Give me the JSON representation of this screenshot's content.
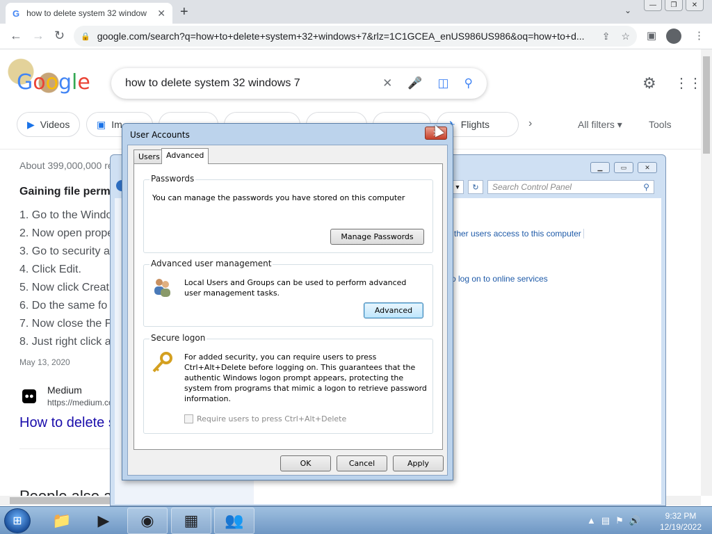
{
  "browser": {
    "tab_title": "how to delete system 32 window",
    "favicon": "G",
    "url": "google.com/search?q=how+to+delete+system+32+windows+7&rlz=1C1GCEA_enUS986US986&oq=how+to+d..."
  },
  "google": {
    "logo": "Google",
    "query": "how to delete system 32 windows 7",
    "chips": [
      "Videos",
      "Im",
      "",
      "",
      "",
      "",
      "Flights"
    ],
    "all_filters": "All filters",
    "tools": "Tools",
    "stats": "About 399,000,000 re",
    "result_heading": "Gaining file perm",
    "steps": [
      "1. Go to the Windo",
      "2. Now open prope",
      "3. Go to security a",
      "4. Click Edit.",
      "5. Now click Creat",
      "6. Do the same fo",
      "7. Now close the F",
      "8. Just right click a"
    ],
    "date": "May 13, 2020",
    "source_name": "Medium",
    "source_url": "https://medium.co",
    "result_link": "How to delete s",
    "people_also": "People also a"
  },
  "control_panel": {
    "search_placeholder": "Search Control Panel",
    "link1": "ther users access to this computer",
    "link2": "o log on to online services"
  },
  "dialog": {
    "title": "User Accounts",
    "tabs": [
      "Users",
      "Advanced"
    ],
    "passwords": {
      "label": "Passwords",
      "text": "You can manage the passwords you have stored on this computer",
      "button": "Manage Passwords"
    },
    "advanced": {
      "label": "Advanced user management",
      "text": "Local Users and Groups can be used to perform advanced user management tasks.",
      "button": "Advanced"
    },
    "secure": {
      "label": "Secure logon",
      "text": "For added security, you can require users to press Ctrl+Alt+Delete before logging on. This guarantees that the authentic Windows logon prompt appears, protecting the system from programs that mimic a logon to retrieve password information.",
      "checkbox": "Require users to press Ctrl+Alt+Delete"
    },
    "buttons": {
      "ok": "OK",
      "cancel": "Cancel",
      "apply": "Apply"
    }
  },
  "taskbar": {
    "time": "9:32 PM",
    "date": "12/19/2022"
  }
}
